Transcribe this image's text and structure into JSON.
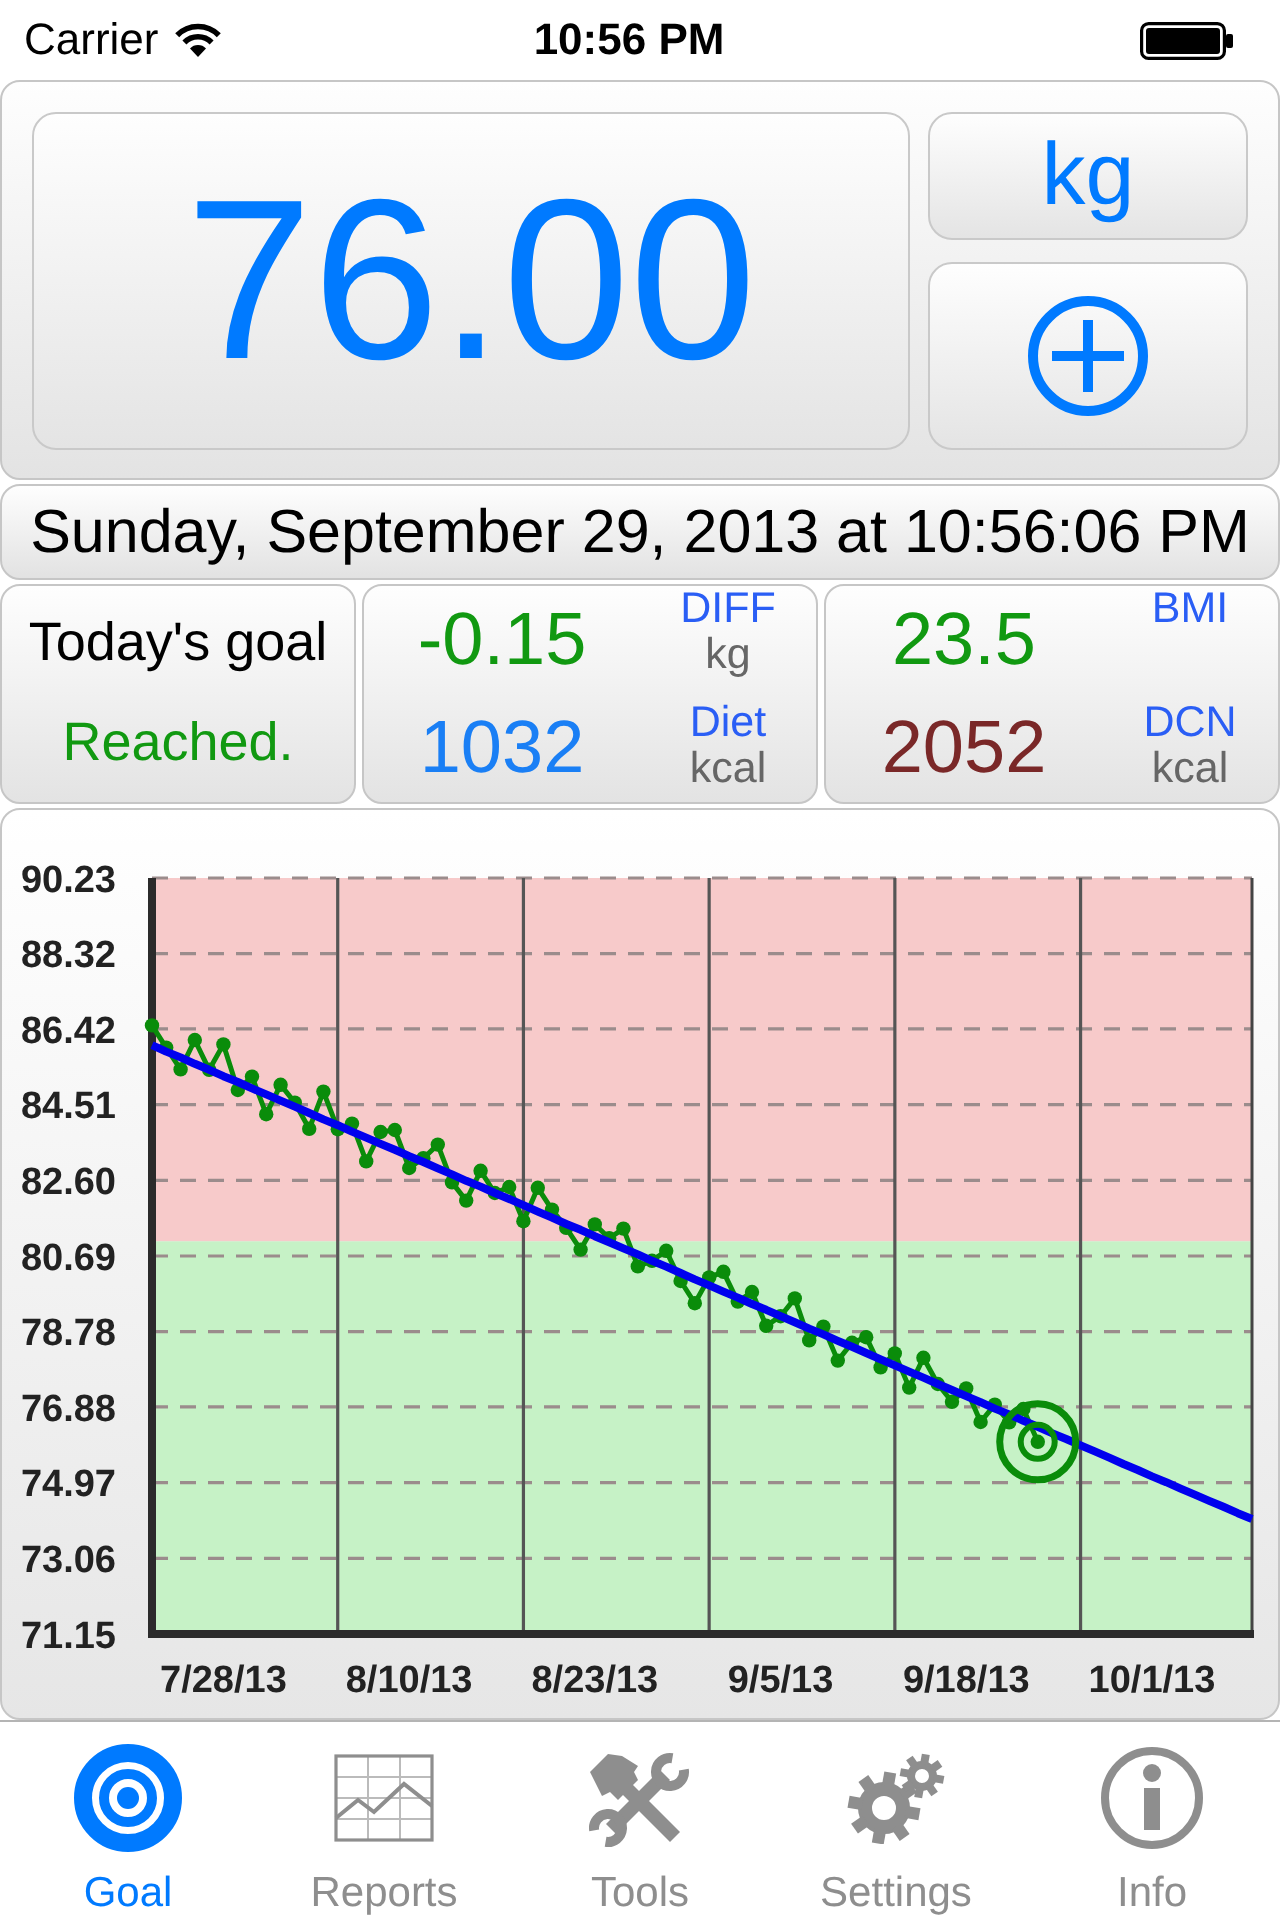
{
  "status_bar": {
    "carrier": "Carrier",
    "time": "10:56 PM"
  },
  "weight_panel": {
    "value": "76.00",
    "unit": "kg"
  },
  "timestamp": "Sunday, September 29, 2013 at 10:56:06 PM",
  "goal_card": {
    "title": "Today's goal",
    "status": "Reached."
  },
  "stat_cards": [
    {
      "items": [
        {
          "value": "-0.15",
          "label": "DIFF",
          "unit": "kg",
          "color": "#119911"
        },
        {
          "value": "1032",
          "label": "Diet",
          "unit": "kcal",
          "color": "#1a7ff5"
        }
      ]
    },
    {
      "items": [
        {
          "value": "23.5",
          "label": "BMI",
          "color": "#119911"
        },
        {
          "value": "2052",
          "label": "DCN",
          "unit": "kcal",
          "color": "#7a2828"
        }
      ]
    }
  ],
  "chart": {
    "chart_data": {
      "type": "line",
      "grid": true,
      "ylim": [
        71.15,
        90.23
      ],
      "categories": [
        null,
        null,
        null,
        null,
        null,
        "7/28/13",
        null,
        null,
        null,
        null,
        null,
        null,
        null,
        null,
        null,
        null,
        null,
        null,
        "8/10/13",
        null,
        null,
        null,
        null,
        null,
        null,
        null,
        null,
        null,
        null,
        null,
        null,
        "8/23/13",
        null,
        null,
        null,
        null,
        null,
        null,
        null,
        null,
        null,
        null,
        null,
        null,
        "9/5/13",
        null,
        null,
        null,
        null,
        null,
        null,
        null,
        null,
        null,
        null,
        null,
        null,
        "9/18/13",
        null,
        null,
        null,
        null,
        null,
        null,
        null,
        null,
        null,
        null,
        null,
        null,
        "10/1/13",
        null,
        null,
        null,
        null,
        null,
        null,
        null
      ],
      "yticks": [
        {
          "value": 71.15,
          "label": "71.15"
        },
        {
          "value": 73.06,
          "label": "73.06"
        },
        {
          "value": 74.97,
          "label": "74.97"
        },
        {
          "value": 76.88,
          "label": "76.88"
        },
        {
          "value": 78.78,
          "label": "78.78"
        },
        {
          "value": 80.69,
          "label": "80.69"
        },
        {
          "value": 82.6,
          "label": "82.60"
        },
        {
          "value": 84.51,
          "label": "84.51"
        },
        {
          "value": 86.42,
          "label": "86.42"
        },
        {
          "value": 88.32,
          "label": "88.32"
        },
        {
          "value": 90.23,
          "label": "90.23"
        }
      ],
      "series": [
        {
          "color": "#0a8c0a",
          "marker": "circle",
          "values": [
            86.51,
            85.95,
            85.4,
            86.14,
            85.39,
            86.03,
            84.88,
            85.22,
            84.27,
            85.01,
            84.56,
            83.9,
            84.84,
            83.89,
            84.03,
            83.08,
            83.82,
            83.87,
            82.91,
            83.16,
            83.5,
            82.55,
            82.09,
            82.84,
            82.28,
            82.43,
            81.57,
            82.41,
            81.86,
            81.4,
            80.85,
            81.49,
            81.14,
            81.38,
            80.43,
            80.57,
            80.82,
            80.06,
            79.5,
            80.15,
            80.29,
            79.54,
            79.78,
            78.93,
            79.17,
            79.62,
            78.56,
            78.91,
            78.05,
            78.5,
            78.64,
            77.88,
            78.23,
            77.37,
            78.12,
            77.46,
            77.01,
            77.35,
            76.5,
            76.94,
            76.49,
            76.83,
            76.0,
            null,
            null,
            null,
            null,
            null,
            null,
            null,
            null,
            null,
            null,
            null,
            null,
            null,
            null,
            null
          ]
        },
        {
          "color": "#0000ee",
          "values": [
            86.01,
            85.85,
            85.7,
            85.54,
            85.39,
            85.23,
            85.08,
            84.92,
            84.77,
            84.61,
            84.46,
            84.3,
            84.14,
            83.99,
            83.83,
            83.68,
            83.52,
            83.37,
            83.21,
            83.06,
            82.9,
            82.75,
            82.59,
            82.44,
            82.28,
            82.13,
            81.97,
            81.81,
            81.66,
            81.5,
            81.35,
            81.19,
            81.04,
            80.88,
            80.73,
            80.57,
            80.42,
            80.26,
            80.1,
            79.95,
            79.79,
            79.64,
            79.48,
            79.33,
            79.17,
            79.02,
            78.86,
            78.71,
            78.55,
            78.4,
            78.24,
            78.08,
            77.93,
            77.77,
            77.62,
            77.46,
            77.31,
            77.15,
            77.0,
            76.84,
            76.69,
            76.53,
            76.38,
            76.22,
            76.07,
            75.91,
            75.76,
            75.6,
            75.44,
            75.29,
            75.13,
            74.98,
            74.82,
            74.67,
            74.51,
            74.36,
            74.2,
            74.05
          ]
        }
      ],
      "bands": [
        {
          "axis": "y",
          "from": 81.06,
          "to": 90.23,
          "color": "#f7caca"
        },
        {
          "axis": "y",
          "from": 71.15,
          "to": 81.06,
          "color": "#c6f2c6"
        }
      ]
    }
  },
  "tabs": [
    {
      "label": "Goal",
      "selected": true
    },
    {
      "label": "Reports",
      "selected": false
    },
    {
      "label": "Tools",
      "selected": false
    },
    {
      "label": "Settings",
      "selected": false
    },
    {
      "label": "Info",
      "selected": false
    }
  ]
}
